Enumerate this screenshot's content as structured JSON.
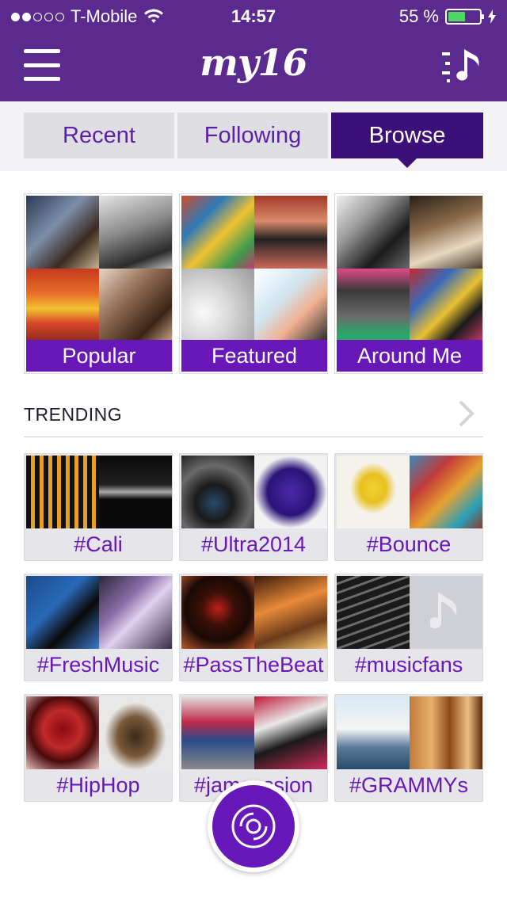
{
  "status_bar": {
    "carrier": "T-Mobile",
    "signal_dots_filled": 2,
    "signal_dots_total": 5,
    "time": "14:57",
    "battery_percent_text": "55 %",
    "battery_level": 0.55,
    "battery_color": "#4cd964"
  },
  "navbar": {
    "logo": "my16",
    "menu_icon": "hamburger-icon",
    "music_icon": "music-note-list-icon",
    "background": "#5b2a8e"
  },
  "tabs": [
    {
      "label": "Recent",
      "active": false
    },
    {
      "label": "Following",
      "active": false
    },
    {
      "label": "Browse",
      "active": true
    }
  ],
  "browse": [
    {
      "label": "Popular",
      "images": [
        "guitarist",
        "clarinet-player",
        "festival-poster",
        "guitar-closeup"
      ]
    },
    {
      "label": "Featured",
      "images": [
        "graffiti-wall",
        "band-with-boombox",
        "bicycle-sketch",
        "boy-with-boombox"
      ]
    },
    {
      "label": "Around Me",
      "images": [
        "drummer",
        "woman-in-dress",
        "london-calling-cover",
        "john-lennon-art"
      ]
    }
  ],
  "trending": {
    "title": "TRENDING",
    "chevron_icon": "chevron-right-icon",
    "items": [
      {
        "label": "#Cali",
        "images": [
          "equalizer-display",
          "equalizer-display-2"
        ]
      },
      {
        "label": "#Ultra2014",
        "images": [
          "turntable-dj",
          "guitar-pick"
        ]
      },
      {
        "label": "#Bounce",
        "images": [
          "banana-album-cover",
          "mosaic-art"
        ]
      },
      {
        "label": "#FreshMusic",
        "images": [
          "person-with-headphones",
          "guitar-neck"
        ]
      },
      {
        "label": "#PassTheBeat",
        "images": [
          "vinyl-record",
          "blurred-lights"
        ]
      },
      {
        "label": "#musicfans",
        "images": [
          "keyboard-keys",
          "music-note-placeholder"
        ]
      },
      {
        "label": "#HipHop",
        "images": [
          "red-rose",
          "person-back-headphones"
        ]
      },
      {
        "label": "#jamsession",
        "images": [
          "street-performers",
          "vinyl-sleeve"
        ]
      },
      {
        "label": "#GRAMMYs",
        "images": [
          "sydney-opera-house",
          "ukuleles"
        ]
      }
    ]
  },
  "fab": {
    "icon": "vinyl-disc-icon",
    "color": "#6817b8"
  }
}
